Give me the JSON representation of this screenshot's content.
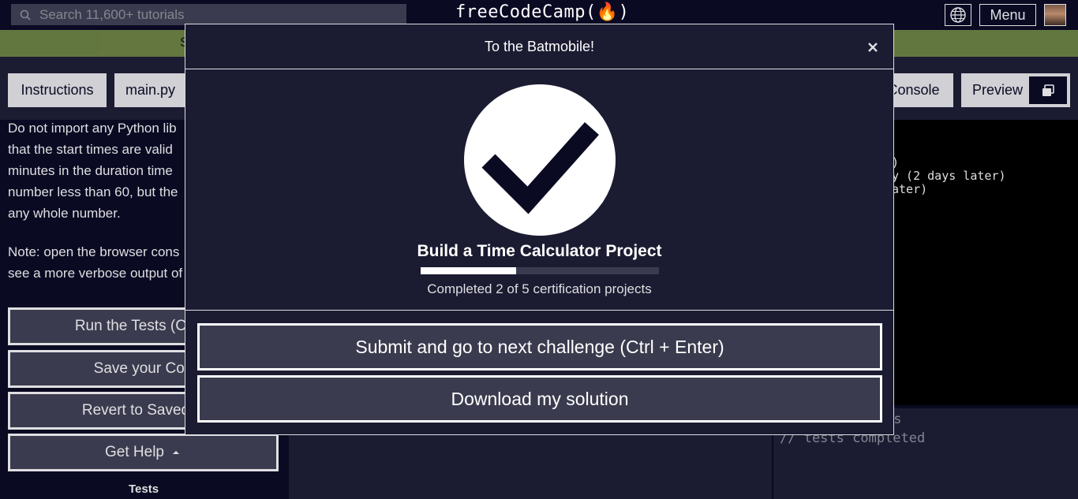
{
  "nav": {
    "search_placeholder": "Search 11,600+ tutorials",
    "logo_text": "freeCodeCamp(🔥)",
    "menu_label": "Menu"
  },
  "banner": {
    "text": "S"
  },
  "tabs": {
    "instructions": "Instructions",
    "main_file": "main.py",
    "console": "Console",
    "preview": "Preview"
  },
  "instructions": {
    "lines": [
      "Do not import any Python lib",
      "that the start times are valid",
      "minutes in the duration time",
      "number less than 60, but the",
      "any whole number.",
      "Note: open the browser cons",
      "see a more verbose output of"
    ]
  },
  "side_buttons": {
    "run_tests": "Run the Tests (Ctrl +",
    "save_code": "Save your Cod",
    "revert": "Revert to Saved C",
    "get_help": "Get Help"
  },
  "tests_label": "Tests",
  "console": {
    "lines": [
      ")",
      "y (2 days later)",
      "ater)"
    ]
  },
  "output": {
    "line1": "ts",
    "line2": "// tests completed"
  },
  "modal": {
    "title": "To the Batmobile!",
    "project_title": "Build a Time Calculator Project",
    "completed_count": 2,
    "total_count": 5,
    "progress_text": "Completed 2 of 5 certification projects",
    "submit_label": "Submit and go to next challenge (Ctrl + Enter)",
    "download_label": "Download my solution"
  },
  "colors": {
    "background": "#0a0a23",
    "panel": "#1b1b32",
    "button": "#3b3b4f",
    "text": "#dfdfe2",
    "banner": "#acd157"
  },
  "icons": {
    "search": "search-icon",
    "language": "globe-icon",
    "close": "close-icon",
    "check": "checkmark-icon",
    "preview": "copy-window-icon",
    "caret": "caret-up-icon"
  }
}
